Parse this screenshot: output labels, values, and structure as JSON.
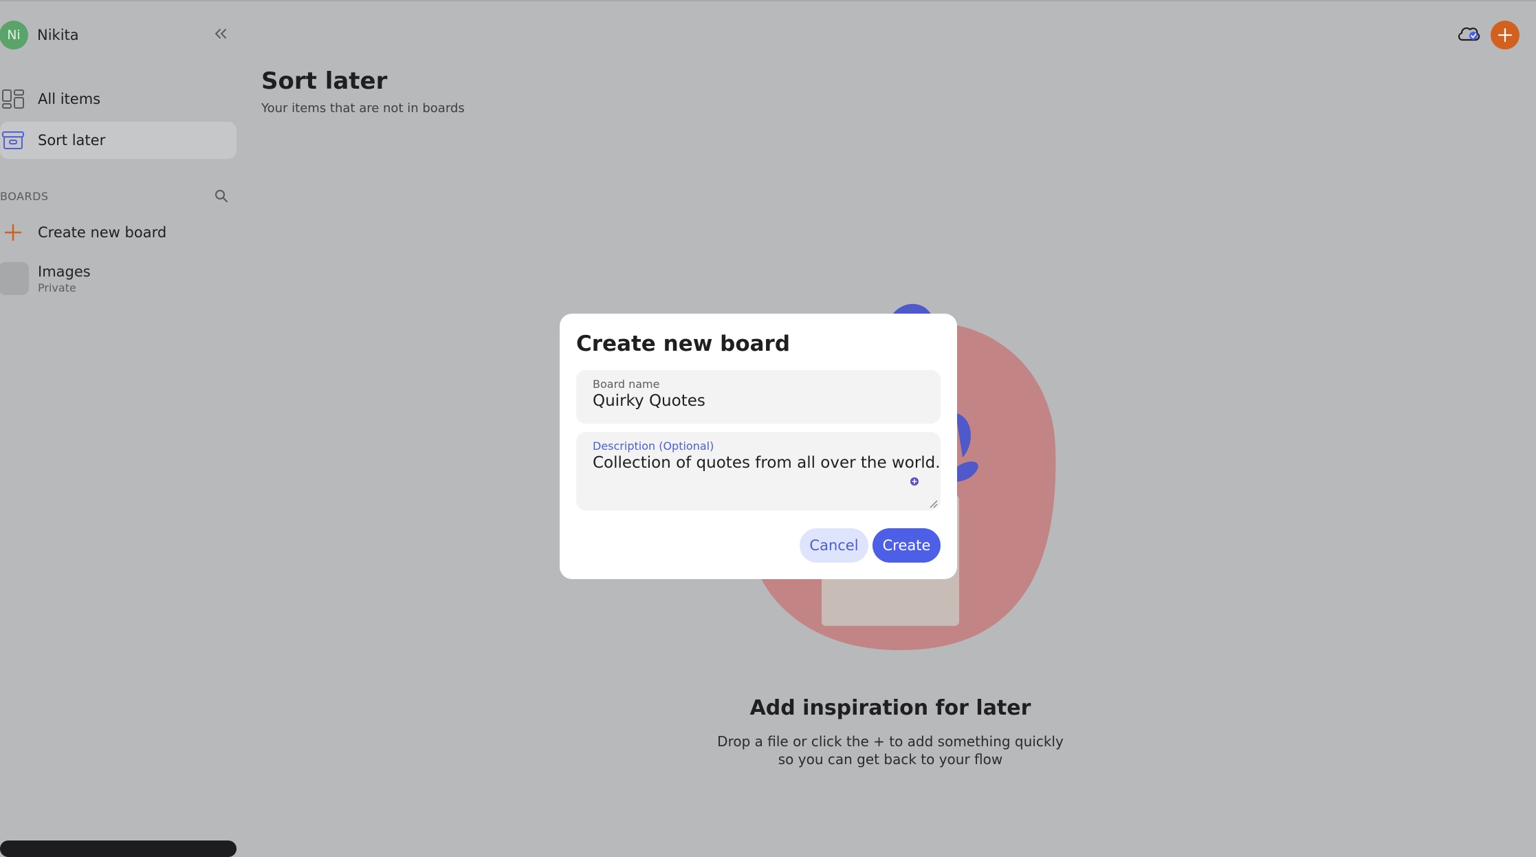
{
  "user": {
    "initials": "Ni",
    "name": "Nikita"
  },
  "sidebar": {
    "items": [
      {
        "label": "All items",
        "icon": "grid-icon"
      },
      {
        "label": "Sort later",
        "icon": "archive-box-icon",
        "active": true
      }
    ],
    "boards_header": "BOARDS",
    "create_board_label": "Create new board",
    "boards": [
      {
        "name": "Images",
        "visibility": "Private"
      }
    ]
  },
  "page": {
    "title": "Sort later",
    "subtitle": "Your items that are not in boards"
  },
  "empty_state": {
    "title": "Add inspiration for later",
    "description": "Drop a file or click the + to add something quickly so you can get back to your flow"
  },
  "modal": {
    "title": "Create new board",
    "name_field": {
      "label": "Board name",
      "value": "Quirky Quotes"
    },
    "description_field": {
      "label": "Description (Optional)",
      "value": "Collection of quotes from all over the world."
    },
    "cancel_label": "Cancel",
    "create_label": "Create"
  },
  "colors": {
    "accent": "#4c5fe6",
    "brand_orange": "#d2611f",
    "avatar_green": "#5aa36a",
    "overlay_background": "#b8b9bb"
  }
}
